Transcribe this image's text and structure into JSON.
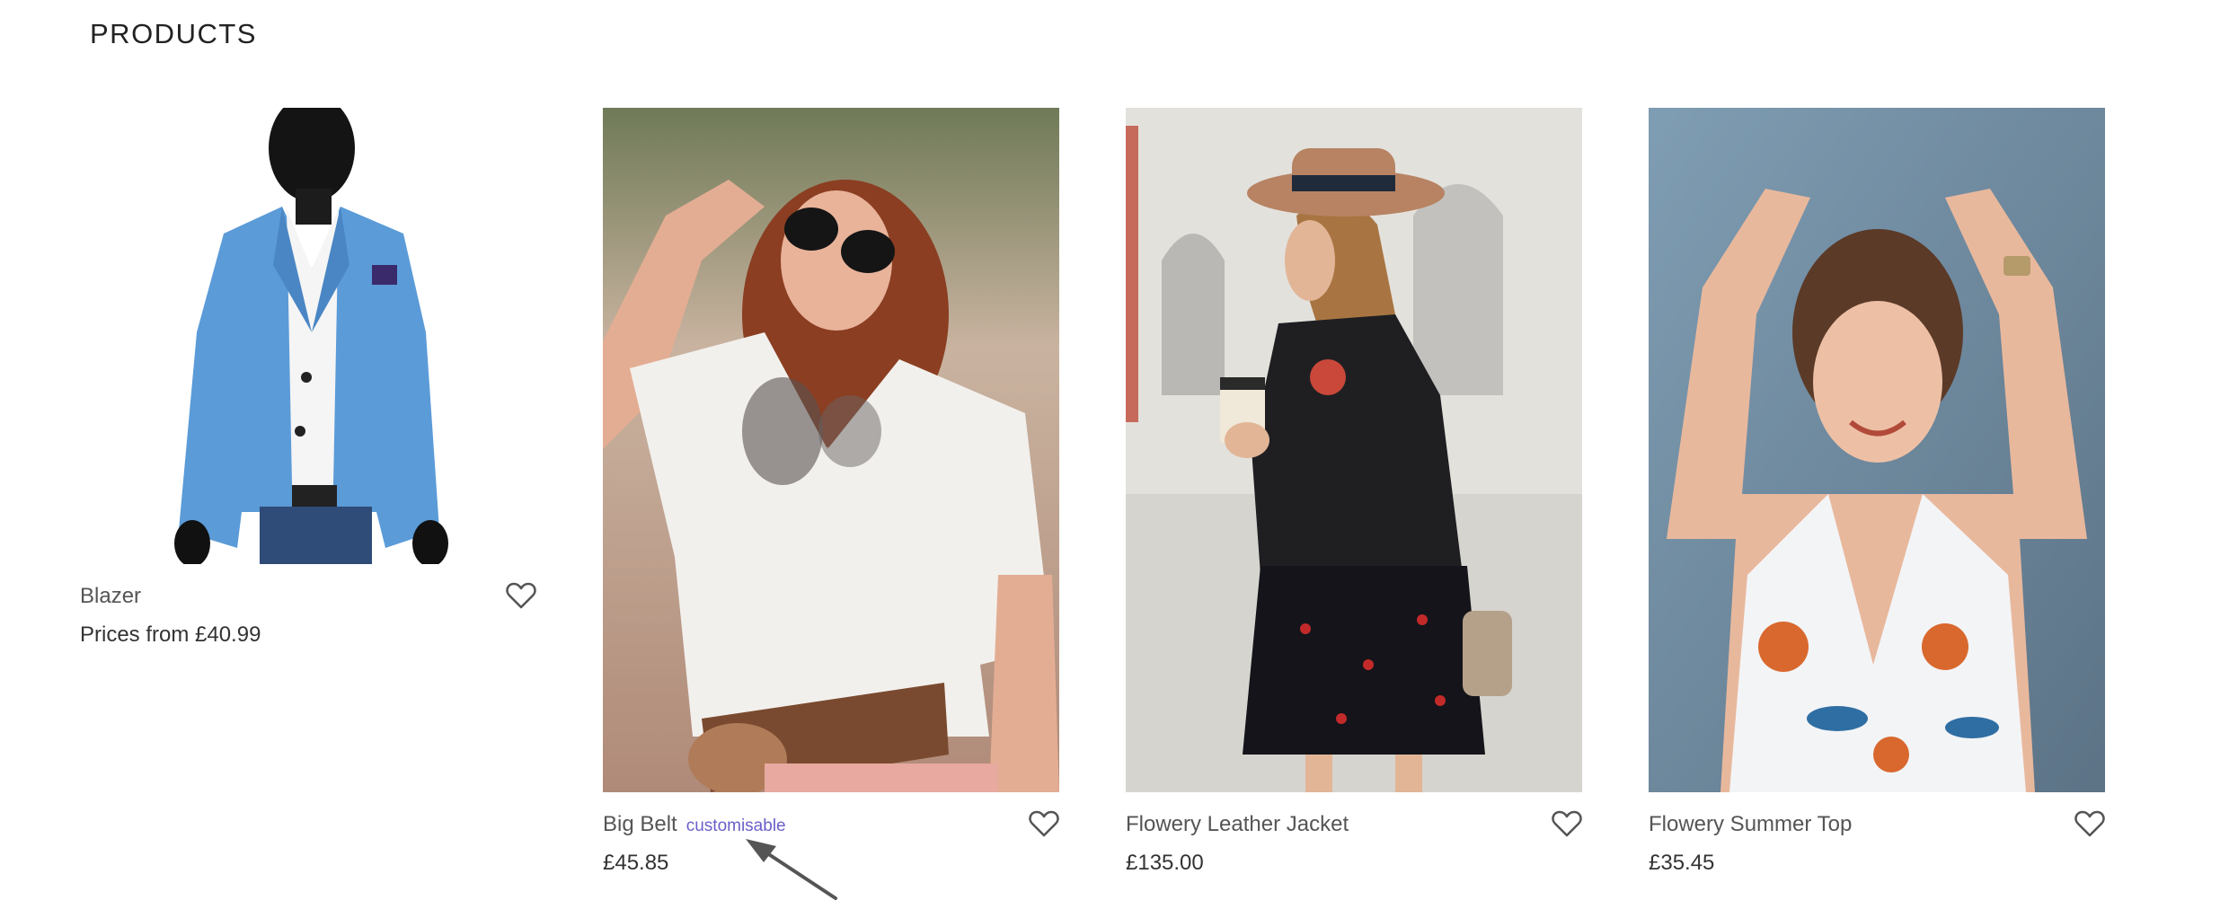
{
  "section": {
    "title": "PRODUCTS"
  },
  "products": [
    {
      "name": "Blazer",
      "badge": "",
      "price": "Prices from £40.99",
      "image": "blazer-photo",
      "favorite_icon": "heart-icon"
    },
    {
      "name": "Big Belt",
      "badge": "customisable",
      "price": "£45.85",
      "image": "big-belt-photo",
      "favorite_icon": "heart-icon"
    },
    {
      "name": "Flowery Leather Jacket",
      "badge": "",
      "price": "£135.00",
      "image": "flowery-leather-jacket-photo",
      "favorite_icon": "heart-icon"
    },
    {
      "name": "Flowery Summer Top",
      "badge": "",
      "price": "£35.45",
      "image": "flowery-summer-top-photo",
      "favorite_icon": "heart-icon"
    }
  ],
  "colors": {
    "badge": "#6a5fc9",
    "text": "#555555",
    "price": "#333333",
    "arrow": "#555555"
  },
  "annotation": {
    "icon": "arrow-icon"
  }
}
